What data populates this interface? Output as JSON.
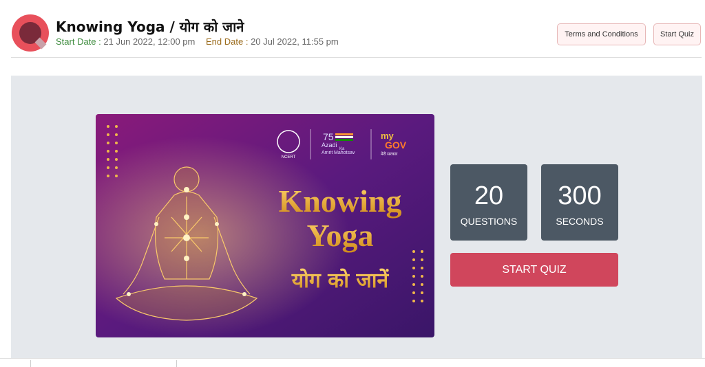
{
  "header": {
    "title": "Knowing Yoga / योग को जाने",
    "start_label": "Start Date :",
    "start_value": "21 Jun 2022, 12:00 pm",
    "end_label": "End Date :",
    "end_value": "20 Jul 2022, 11:55 pm",
    "terms_label": "Terms and Conditions",
    "start_quiz_label": "Start Quiz"
  },
  "banner": {
    "line1": "Knowing",
    "line2": "Yoga",
    "line3": "योग को जानें",
    "azadi_line1": "Azadi",
    "azadi_line2": "Amrit",
    "azadi_ka": "Ka",
    "azadi_line3": "Mahotsav",
    "azadi_75": "75",
    "mygov_my": "my",
    "mygov_gov": "GOV",
    "mygov_tag": "मेरी सरकार",
    "ncert_label": "NCERT"
  },
  "stats": {
    "questions_value": "20",
    "questions_label": "QUESTIONS",
    "seconds_value": "300",
    "seconds_label": "SECONDS"
  },
  "actions": {
    "start_quiz_button": "START QUIZ"
  },
  "colors": {
    "accent": "#d0465c",
    "stat_bg": "#4c5864",
    "panel_bg": "#e5e8ec"
  }
}
